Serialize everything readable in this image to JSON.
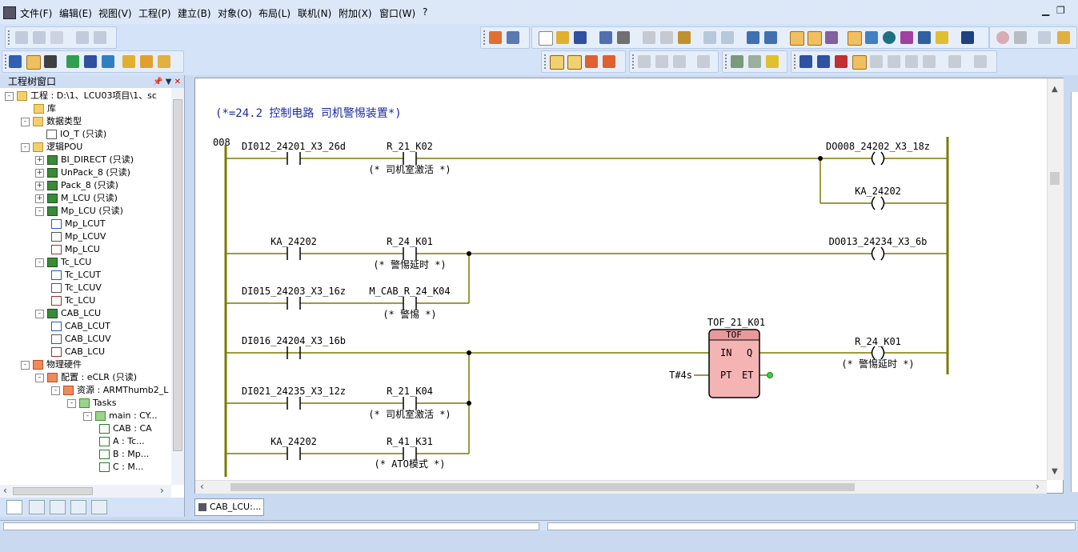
{
  "menu": [
    "文件(F)",
    "编辑(E)",
    "视图(V)",
    "工程(P)",
    "建立(B)",
    "对象(O)",
    "布局(L)",
    "联机(N)",
    "附加(X)",
    "窗口(W)",
    "?"
  ],
  "tree": {
    "title": "工程树窗口",
    "rows": [
      {
        "label": "工程 : D:\\1、LCU03项目\\1、sc",
        "exp": "-",
        "icon": "folder"
      },
      {
        "label": "库",
        "exp": "",
        "icon": "folder"
      },
      {
        "label": "数据类型",
        "exp": "-",
        "icon": "folder"
      },
      {
        "label": "IO_T (只读)",
        "exp": "",
        "icon": "doc"
      },
      {
        "label": "逻辑POU",
        "exp": "-",
        "icon": "folder"
      },
      {
        "label": "BI_DIRECT (只读)",
        "exp": "+",
        "icon": "pou"
      },
      {
        "label": "UnPack_8 (只读)",
        "exp": "+",
        "icon": "pou"
      },
      {
        "label": "Pack_8 (只读)",
        "exp": "+",
        "icon": "pou"
      },
      {
        "label": "M_LCU (只读)",
        "exp": "+",
        "icon": "pou"
      },
      {
        "label": "Mp_LCU (只读)",
        "exp": "-",
        "icon": "pou"
      },
      {
        "label": "Mp_LCUT",
        "exp": "",
        "icon": "info"
      },
      {
        "label": "Mp_LCUV",
        "exp": "",
        "icon": "doc"
      },
      {
        "label": "Mp_LCU",
        "exp": "",
        "icon": "grid"
      },
      {
        "label": "Tc_LCU",
        "exp": "-",
        "icon": "pou"
      },
      {
        "label": "Tc_LCUT",
        "exp": "",
        "icon": "info"
      },
      {
        "label": "Tc_LCUV",
        "exp": "",
        "icon": "doc"
      },
      {
        "label": "Tc_LCU",
        "exp": "",
        "icon": "grid"
      },
      {
        "label": "CAB_LCU",
        "exp": "-",
        "icon": "pou"
      },
      {
        "label": "CAB_LCUT",
        "exp": "",
        "icon": "info"
      },
      {
        "label": "CAB_LCUV",
        "exp": "",
        "icon": "doc"
      },
      {
        "label": "CAB_LCU",
        "exp": "",
        "icon": "grid"
      },
      {
        "label": "物理硬件",
        "exp": "-",
        "icon": "folder-red"
      },
      {
        "label": "配置 : eCLR (只读)",
        "exp": "-",
        "icon": "folder-red"
      },
      {
        "label": "资源 : ARMThumb2_L",
        "exp": "-",
        "icon": "folder-red"
      },
      {
        "label": "Tasks",
        "exp": "-",
        "icon": "folder-green"
      },
      {
        "label": "main : CY...",
        "exp": "-",
        "icon": "folder-green"
      },
      {
        "label": "CAB : CA",
        "exp": "",
        "icon": "task"
      },
      {
        "label": "A : Tc...",
        "exp": "",
        "icon": "task"
      },
      {
        "label": "B : Mp...",
        "exp": "",
        "icon": "task"
      },
      {
        "label": "C : M...",
        "exp": "",
        "icon": "task"
      }
    ]
  },
  "editor": {
    "tab_label": "CAB_LCU:...",
    "comment": "(*=24.2 控制电路 司机警惕装置*)",
    "network_no": "008",
    "contacts": [
      {
        "var": "DI012_24201_X3_26d",
        "comment": ""
      },
      {
        "var": "R_21_K02",
        "comment": "(* 司机室激活 *)"
      },
      {
        "var": "KA_24202",
        "comment": ""
      },
      {
        "var": "R_24_K01",
        "comment": "(* 警惕延时 *)"
      },
      {
        "var": "DI015_24203_X3_16z",
        "comment": ""
      },
      {
        "var": "M_CAB_R_24_K04",
        "comment": "(* 警惕 *)"
      },
      {
        "var": "DI016_24204_X3_16b",
        "comment": ""
      },
      {
        "var": "DI021_24235_X3_12z",
        "comment": ""
      },
      {
        "var": "R_21_K04",
        "comment": "(* 司机室激活 *)"
      },
      {
        "var": "KA_24202",
        "comment": ""
      },
      {
        "var": "R_41_K31",
        "comment": "(* ATO模式 *)"
      }
    ],
    "coils": [
      {
        "var": "DO008_24202_X3_18z",
        "comment": ""
      },
      {
        "var": "KA_24202",
        "comment": ""
      },
      {
        "var": "DO013_24234_X3_6b",
        "comment": ""
      },
      {
        "var": "R_24_K01",
        "comment": "(* 警惕延时 *)"
      }
    ],
    "fb": {
      "instance": "TOF_21_K01",
      "type": "TOF",
      "pin_in": "IN",
      "pin_pt": "PT",
      "pin_q": "Q",
      "pin_et": "ET",
      "pt_value": "T#4s"
    }
  },
  "colors": {
    "rung": "#7a7a00",
    "comment_blue": "#1a2aa0",
    "fb_fill": "#f4b4b4",
    "fb_header": "#e89a9a"
  }
}
